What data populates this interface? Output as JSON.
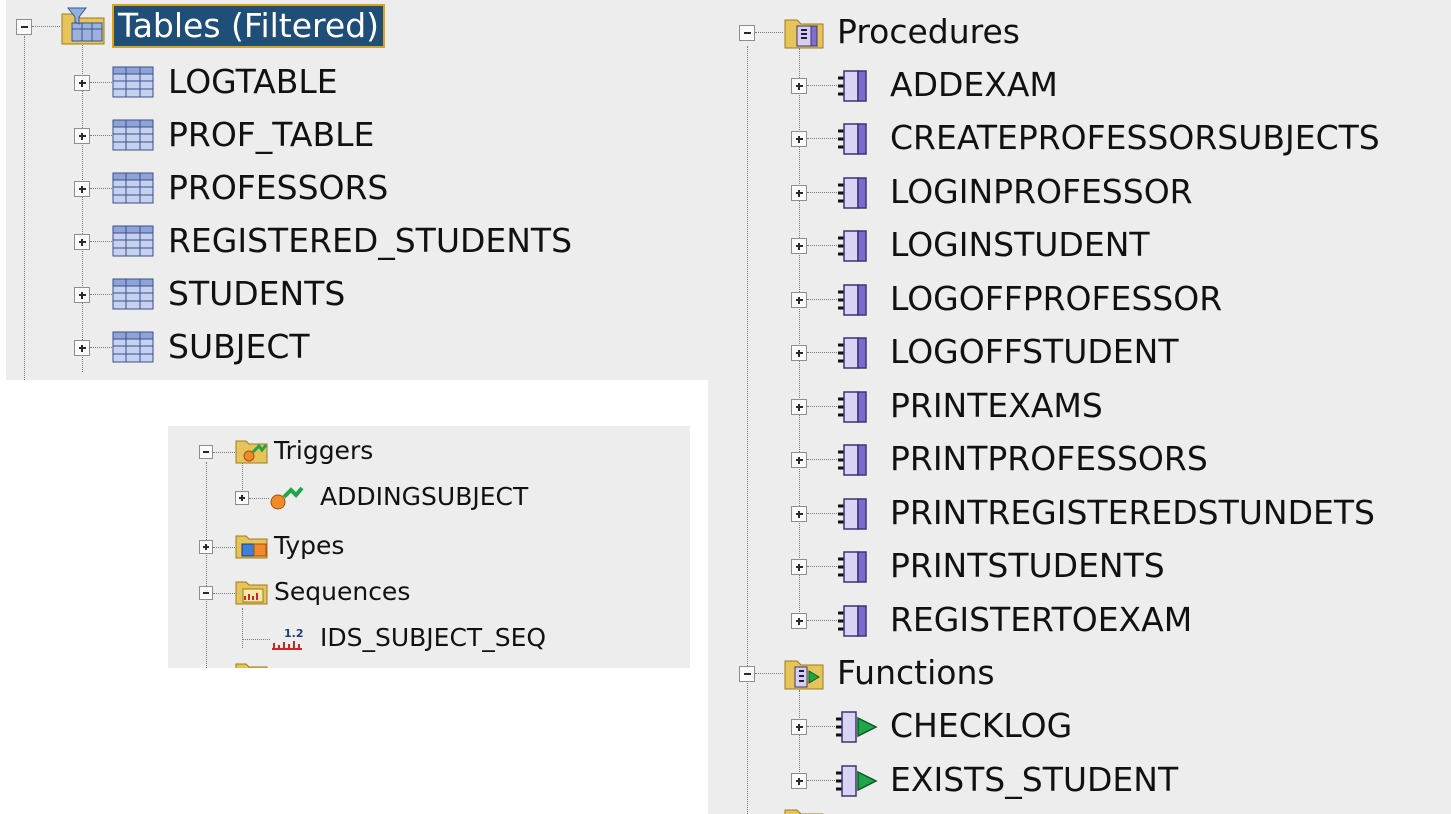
{
  "tables": {
    "header": "Tables (Filtered)",
    "items": [
      "LOGTABLE",
      "PROF_TABLE",
      "PROFESSORS",
      "REGISTERED_STUDENTS",
      "STUDENTS",
      "SUBJECT"
    ]
  },
  "procedures": {
    "header": "Procedures",
    "items": [
      "ADDEXAM",
      "CREATEPROFESSORSUBJECTS",
      "LOGINPROFESSOR",
      "LOGINSTUDENT",
      "LOGOFFPROFESSOR",
      "LOGOFFSTUDENT",
      "PRINTEXAMS",
      "PRINTPROFESSORS",
      "PRINTREGISTEREDSTUNDETS",
      "PRINTSTUDENTS",
      "REGISTERTOEXAM"
    ]
  },
  "functions": {
    "header": "Functions",
    "items": [
      "CHECKLOG",
      "EXISTS_STUDENT"
    ]
  },
  "triggers": {
    "header": "Triggers",
    "items": [
      "ADDINGSUBJECT"
    ]
  },
  "types": {
    "header": "Types"
  },
  "sequences": {
    "header": "Sequences",
    "items": [
      "IDS_SUBJECT_SEQ"
    ]
  },
  "colors": {
    "selection_bg": "#1f4e79",
    "selection_outline": "#d8a41c",
    "panel_bg": "#ededed"
  },
  "icons": [
    "folder-icon",
    "table-icon",
    "procedure-icon",
    "function-icon",
    "trigger-icon",
    "type-icon",
    "sequence-icon"
  ]
}
